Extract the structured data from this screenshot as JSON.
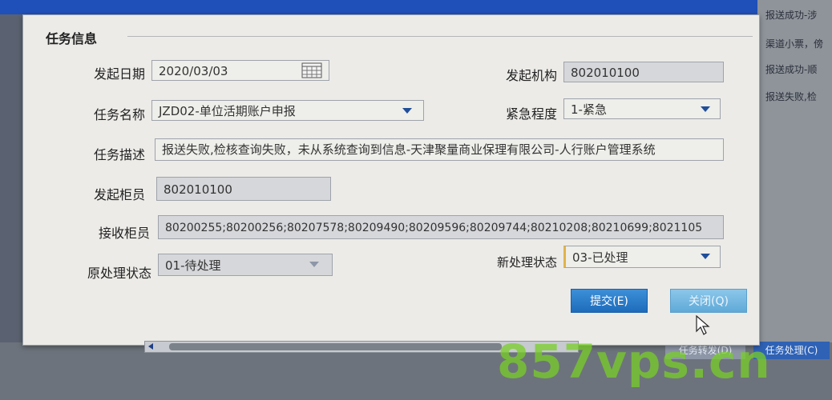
{
  "background": {
    "notes": [
      "报送成功-涉",
      "渠道小票，傍",
      "报送成功-顺",
      "报送失败,检"
    ],
    "bottom_buttons": [
      "任务转发(D)",
      "任务处理(C)"
    ]
  },
  "section": {
    "title": "任务信息"
  },
  "form": {
    "start_date": {
      "label": "发起日期",
      "value": "2020/03/03"
    },
    "start_org": {
      "label": "发起机构",
      "value": "802010100"
    },
    "task_name": {
      "label": "任务名称",
      "value": "JZD02-单位活期账户申报"
    },
    "urgency": {
      "label": "紧急程度",
      "value": "1-紧急"
    },
    "task_desc": {
      "label": "任务描述",
      "value": "报送失败,检核查询失败，未从系统查询到信息-天津聚量商业保理有限公司-人行账户管理系统"
    },
    "start_teller": {
      "label": "发起柜员",
      "value": "802010100"
    },
    "recv_teller": {
      "label": "接收柜员",
      "value": "80200255;80200256;80207578;80209490;80209596;80209744;80210208;80210699;8021105"
    },
    "orig_status": {
      "label": "原处理状态",
      "value": "01-待处理"
    },
    "new_status": {
      "label": "新处理状态",
      "value": "03-已处理"
    }
  },
  "buttons": {
    "submit": "提交(E)",
    "close": "关闭(Q)"
  },
  "watermark": "857vps.cn",
  "colors": {
    "titlebar": "#1f4fb8",
    "submit": "#1d6cbc",
    "close": "#5fa9d8",
    "watermark": "#78cd28"
  }
}
